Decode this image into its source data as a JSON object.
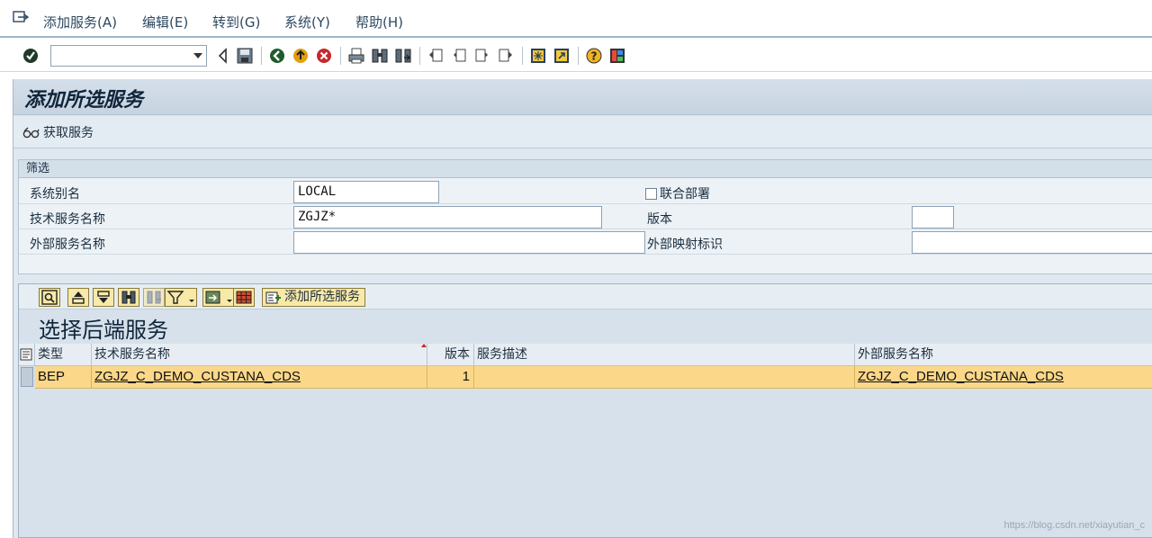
{
  "menu": {
    "items": [
      "添加服务(A)",
      "编辑(E)",
      "转到(G)",
      "系统(Y)",
      "帮助(H)"
    ]
  },
  "toolbar": {
    "command_value": "",
    "icons": [
      "check-icon",
      "back-icon",
      "save-icon",
      "nav-back-icon",
      "exit-icon",
      "cancel-icon",
      "print-icon",
      "find-icon",
      "find-next-icon",
      "first-page-icon",
      "prev-page-icon",
      "next-page-icon",
      "last-page-icon",
      "new-session-icon",
      "shortcut-icon",
      "help-icon",
      "layout-icon"
    ]
  },
  "screen": {
    "title": "添加所选服务",
    "get_services_label": "获取服务"
  },
  "filter": {
    "header": "筛选",
    "system_alias_label": "系统别名",
    "system_alias_value": "LOCAL",
    "tech_service_name_label": "技术服务名称",
    "tech_service_name_value": "ZGJZ*",
    "external_service_name_label": "外部服务名称",
    "external_service_name_value": "",
    "co_deployment_label": "联合部署",
    "co_deployment_checked": false,
    "version_label": "版本",
    "version_value": "",
    "external_mapping_id_label": "外部映射标识",
    "external_mapping_id_value": ""
  },
  "alv": {
    "add_selected_label": "添加所选服务",
    "title": "选择后端服务",
    "columns": [
      "类型",
      "技术服务名称",
      "版本",
      "服务描述",
      "外部服务名称"
    ],
    "rows": [
      {
        "type": "BEP",
        "tech_name": "ZGJZ_C_DEMO_CUSTANA_CDS",
        "version": "1",
        "description": "",
        "external_name": "ZGJZ_C_DEMO_CUSTANA_CDS"
      }
    ]
  },
  "watermark": "https://blog.csdn.net/xiayutian_c"
}
